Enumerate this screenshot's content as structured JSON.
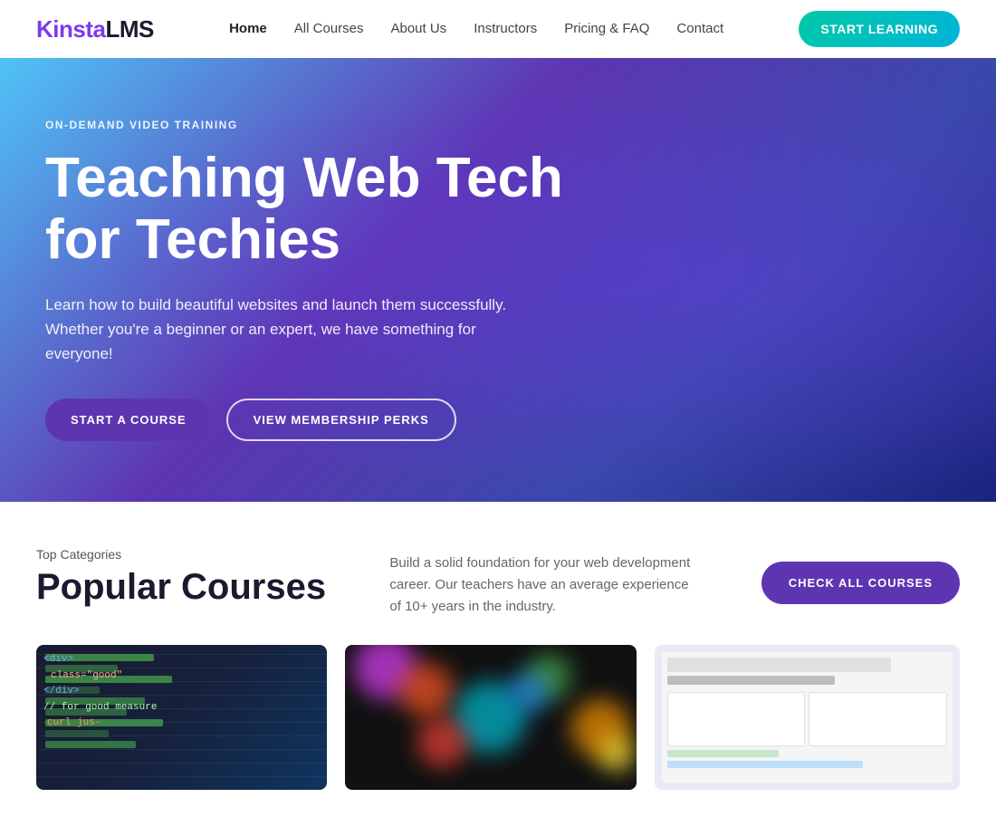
{
  "logo": {
    "kinsta": "Kinsta",
    "lms": "LMS"
  },
  "navbar": {
    "links": [
      {
        "label": "Home",
        "active": true
      },
      {
        "label": "All Courses",
        "active": false
      },
      {
        "label": "About Us",
        "active": false
      },
      {
        "label": "Instructors",
        "active": false
      },
      {
        "label": "Pricing & FAQ",
        "active": false
      },
      {
        "label": "Contact",
        "active": false
      }
    ],
    "cta_label": "START LEARNING"
  },
  "hero": {
    "badge": "ON-DEMAND VIDEO TRAINING",
    "title": "Teaching Web Tech for Techies",
    "subtitle": "Learn how to build beautiful websites and launch them successfully. Whether you're a beginner or an expert, we have something for everyone!",
    "btn_start": "START A COURSE",
    "btn_membership": "VIEW MEMBERSHIP PERKS"
  },
  "courses": {
    "top_categories": "Top Categories",
    "title": "Popular Courses",
    "description": "Build a solid foundation for your web development career. Our teachers have an average experience of 10+ years in the industry.",
    "check_all": "CHECK ALL COURSES"
  },
  "colors": {
    "purple_dark": "#5e35b1",
    "teal": "#00c9a7",
    "hero_gradient_start": "#4fc3f7",
    "hero_gradient_end": "#1a237e"
  }
}
